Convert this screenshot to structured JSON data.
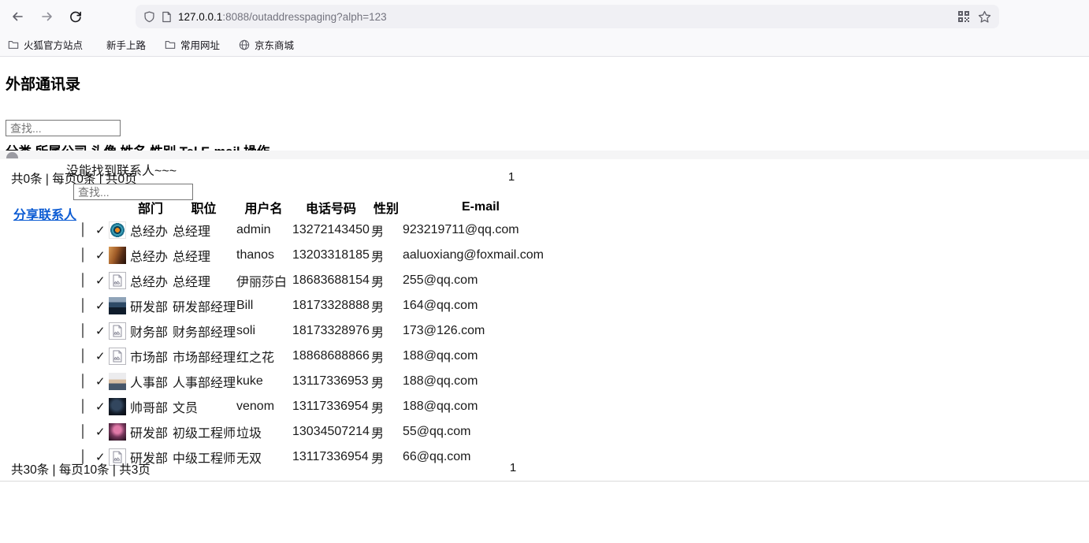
{
  "browser": {
    "url_host": "127.0.0.1",
    "url_rest": ":8088/outaddresspaging?alph=123",
    "bookmarks": [
      {
        "label": "火狐官方站点",
        "icon": "folder-icon"
      },
      {
        "label": "新手上路",
        "icon": "firefox-icon"
      },
      {
        "label": "常用网址",
        "icon": "folder-icon"
      },
      {
        "label": "京东商城",
        "icon": "globe-icon"
      }
    ]
  },
  "icons": {
    "back": "arrow-left",
    "forward": "arrow-right",
    "refresh": "reload-arc",
    "shield": "tracking-shield",
    "page": "document-outline",
    "qr": "qr-code",
    "star": "bookmark-star-outline",
    "check_glyph": "✓"
  },
  "colors": {
    "link_blue": "#0b5bd3",
    "url_dim": "#73737e"
  },
  "page": {
    "title": "外部通讯录",
    "outer": {
      "search_placeholder": "查找...",
      "header": "分类 所属公司 头像 姓名 性别 Tel E-mail 操作",
      "empty_message": "没能找到联系人~~~",
      "pagination": "共0条 | 每页0条 | 共0页",
      "page_number": "1"
    },
    "shared": {
      "search_placeholder": "查找...",
      "share_link": "分享联系人",
      "columns": [
        "部门",
        "职位",
        "用户名",
        "电话号码",
        "性别",
        "E-mail"
      ],
      "check_glyph": "✓",
      "rows": [
        {
          "dept": "总经办",
          "position": "总经理",
          "name": "admin",
          "phone": "13272143450",
          "gender": "男",
          "email": "923219711@qq.com",
          "avatar": "lens-logo"
        },
        {
          "dept": "总经办",
          "position": "总经理",
          "name": "thanos",
          "phone": "13203318185",
          "gender": "男",
          "email": "aaluoxiang@foxmail.com",
          "avatar": "photo-warm"
        },
        {
          "dept": "总经办",
          "position": "总经理",
          "name": "伊丽莎白",
          "phone": "18683688154",
          "gender": "男",
          "email": "255@qq.com",
          "avatar": "broken"
        },
        {
          "dept": "研发部",
          "position": "研发部经理",
          "name": "Bill",
          "phone": "18173328888",
          "gender": "男",
          "email": "164@qq.com",
          "avatar": "photo-suit"
        },
        {
          "dept": "财务部",
          "position": "财务部经理",
          "name": "soli",
          "phone": "18173328976",
          "gender": "男",
          "email": "173@126.com",
          "avatar": "broken"
        },
        {
          "dept": "市场部",
          "position": "市场部经理",
          "name": "红之花",
          "phone": "18868688866",
          "gender": "男",
          "email": "188@qq.com",
          "avatar": "broken"
        },
        {
          "dept": "人事部",
          "position": "人事部经理",
          "name": "kuke",
          "phone": "13117336953",
          "gender": "男",
          "email": "188@qq.com",
          "avatar": "photo-light"
        },
        {
          "dept": "帅哥部",
          "position": "文员",
          "name": "venom",
          "phone": "13117336954",
          "gender": "男",
          "email": "188@qq.com",
          "avatar": "photo-dark"
        },
        {
          "dept": "研发部",
          "position": "初级工程师",
          "name": "垃圾",
          "phone": "13034507214",
          "gender": "男",
          "email": "55@qq.com",
          "avatar": "photo-pink"
        },
        {
          "dept": "研发部",
          "position": "中级工程师",
          "name": "无双",
          "phone": "13117336954",
          "gender": "男",
          "email": "66@qq.com",
          "avatar": "broken"
        }
      ],
      "pagination": "共30条 | 每页10条 | 共3页",
      "page_number": "1"
    }
  }
}
